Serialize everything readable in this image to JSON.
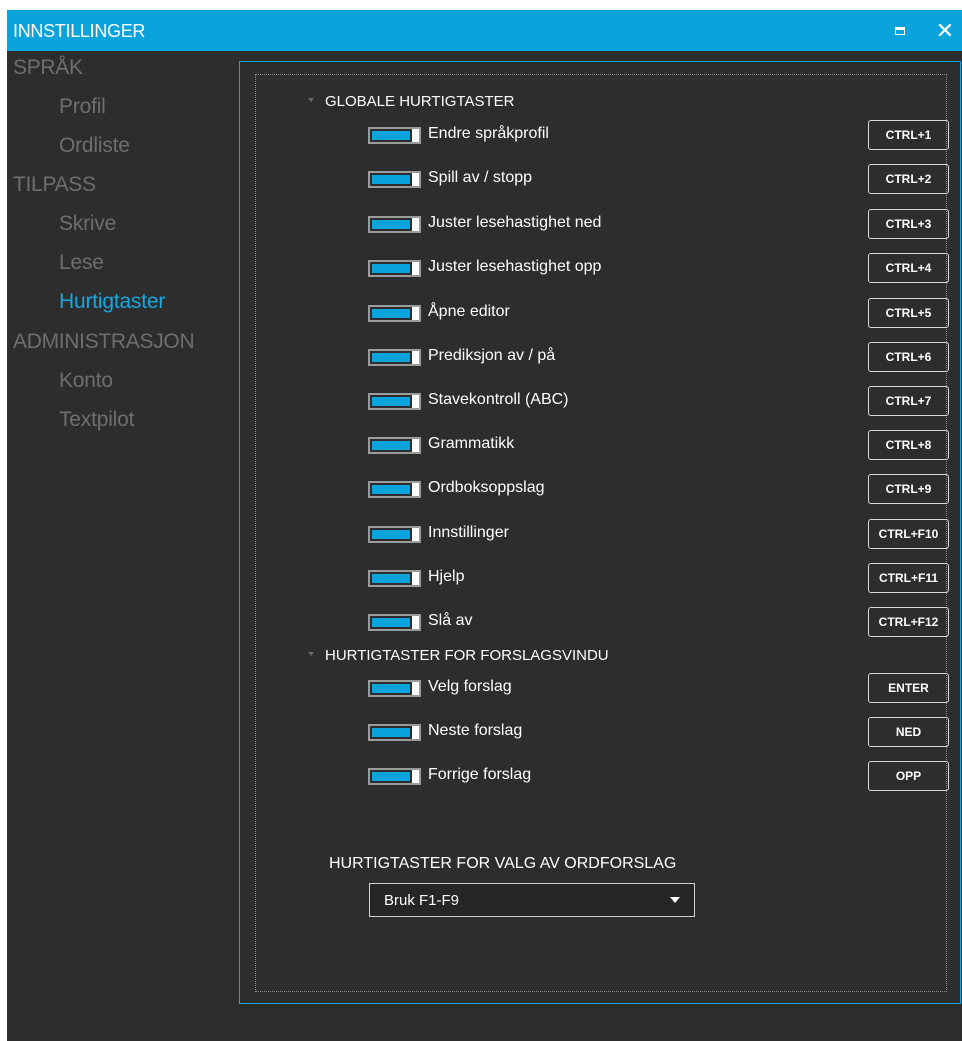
{
  "window": {
    "title": "INNSTILLINGER"
  },
  "sidebar": {
    "sections": [
      {
        "label": "SPRÅK",
        "items": [
          "Profil",
          "Ordliste"
        ]
      },
      {
        "label": "TILPASS",
        "items": [
          "Skrive",
          "Lese",
          "Hurtigtaster"
        ]
      },
      {
        "label": "ADMINISTRASJON",
        "items": [
          "Konto",
          "Textpilot"
        ]
      }
    ],
    "active_item": "Hurtigtaster"
  },
  "colors": {
    "accent": "#0aa3dc",
    "background": "#2d2d2d",
    "muted_text": "#6e6e6e"
  },
  "global_group": {
    "heading": "GLOBALE HURTIGTASTER",
    "rows": [
      {
        "label": "Endre språkprofil",
        "key": "CTRL+1",
        "enabled": true
      },
      {
        "label": "Spill av / stopp",
        "key": "CTRL+2",
        "enabled": true
      },
      {
        "label": "Juster lesehastighet ned",
        "key": "CTRL+3",
        "enabled": true
      },
      {
        "label": "Juster lesehastighet opp",
        "key": "CTRL+4",
        "enabled": true
      },
      {
        "label": "Åpne editor",
        "key": "CTRL+5",
        "enabled": true
      },
      {
        "label": "Prediksjon av / på",
        "key": "CTRL+6",
        "enabled": true
      },
      {
        "label": "Stavekontroll (ABC)",
        "key": "CTRL+7",
        "enabled": true
      },
      {
        "label": "Grammatikk",
        "key": "CTRL+8",
        "enabled": true
      },
      {
        "label": "Ordboksoppslag",
        "key": "CTRL+9",
        "enabled": true
      },
      {
        "label": "Innstillinger",
        "key": "CTRL+F10",
        "enabled": true
      },
      {
        "label": "Hjelp",
        "key": "CTRL+F11",
        "enabled": true
      },
      {
        "label": "Slå av",
        "key": "CTRL+F12",
        "enabled": true
      }
    ]
  },
  "suggestion_group": {
    "heading": "HURTIGTASTER FOR FORSLAGSVINDU",
    "rows": [
      {
        "label": "Velg forslag",
        "key": "ENTER",
        "enabled": true
      },
      {
        "label": "Neste forslag",
        "key": "NED",
        "enabled": true
      },
      {
        "label": "Forrige forslag",
        "key": "OPP",
        "enabled": true
      }
    ]
  },
  "word_choice": {
    "title": "HURTIGTASTER FOR VALG AV ORDFORSLAG",
    "selected": "Bruk F1-F9"
  }
}
